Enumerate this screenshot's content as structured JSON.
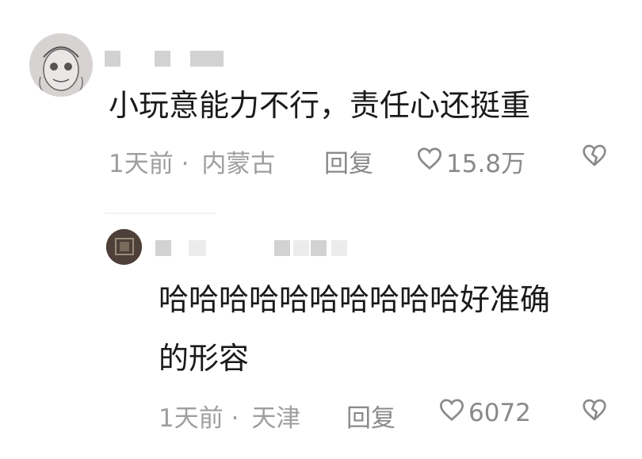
{
  "comments": [
    {
      "text": "小玩意能力不行，责任心还挺重",
      "time": "1天前",
      "sep": "·",
      "location": "内蒙古",
      "reply_label": "回复",
      "likes": "15.8万"
    },
    {
      "text_line1": "哈哈哈哈哈哈哈哈哈哈好准确",
      "text_line2": "的形容",
      "time": "1天前",
      "sep": "·",
      "location": "天津",
      "reply_label": "回复",
      "likes": "6072"
    }
  ],
  "icons": {
    "like": "heart-outline-icon",
    "dislike": "broken-heart-icon"
  },
  "colors": {
    "text": "#1a1a1a",
    "meta": "#9e9e9e",
    "icon": "#8a8a8a"
  }
}
